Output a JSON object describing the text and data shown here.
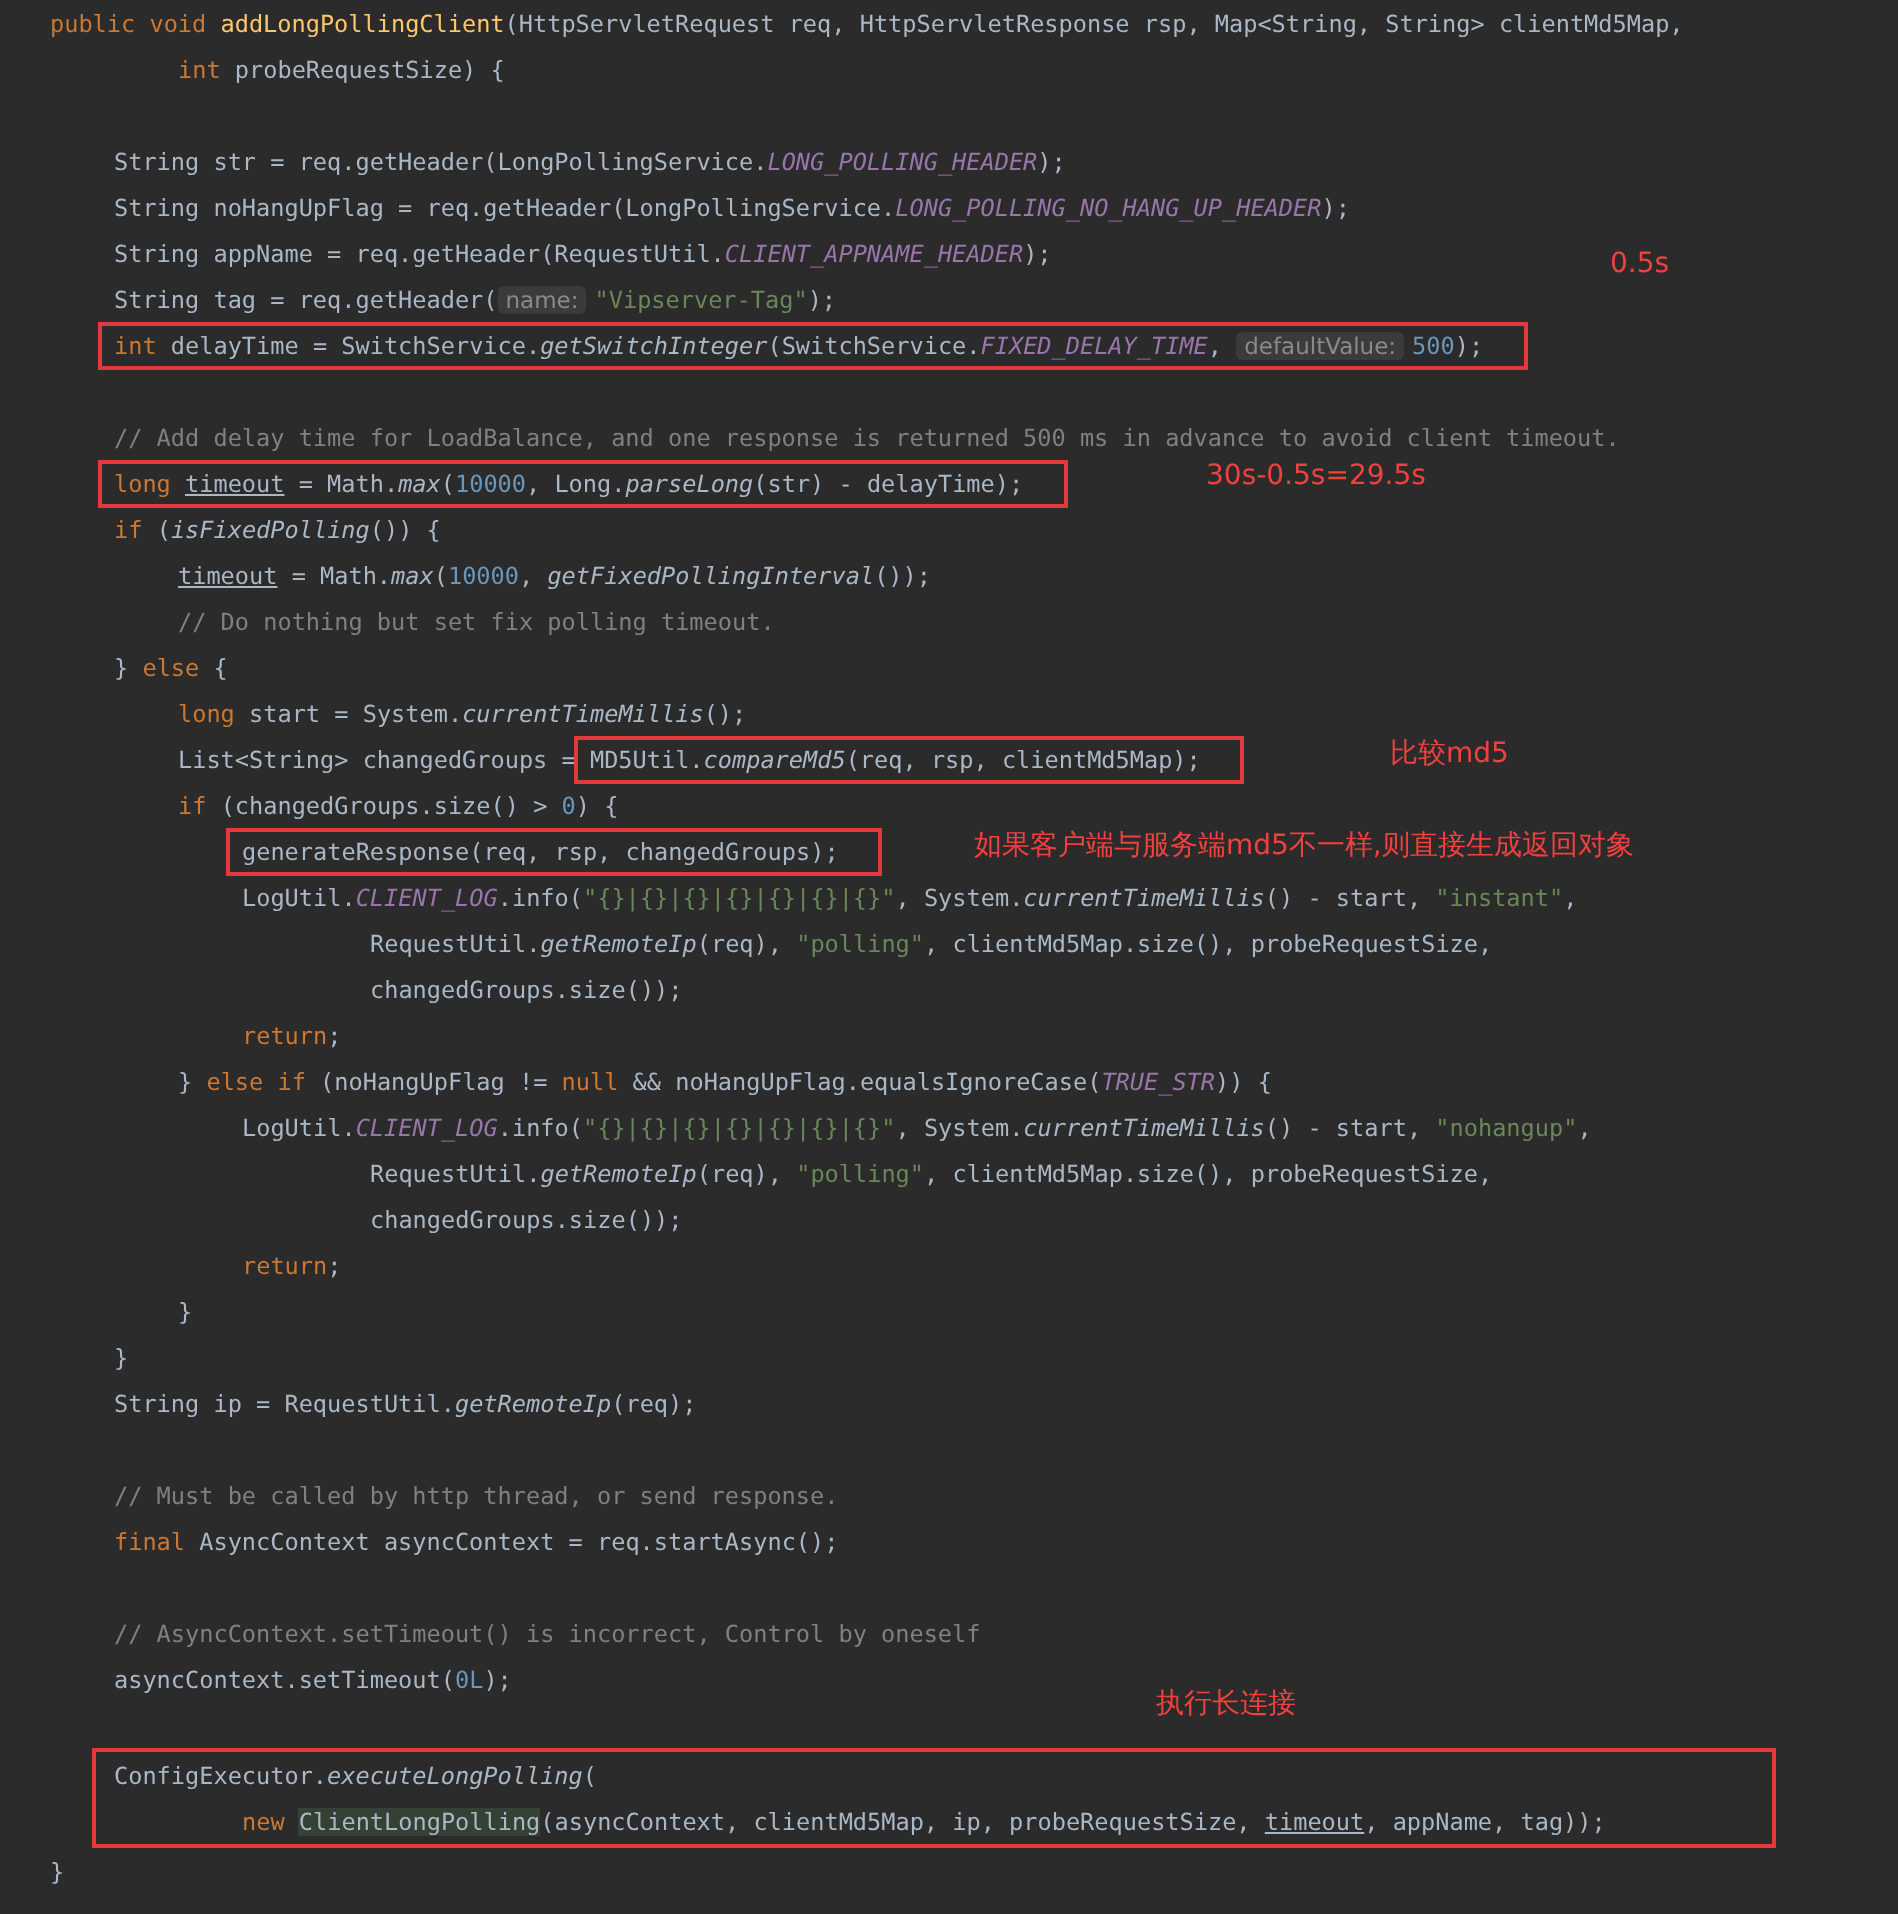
{
  "editor": {
    "lines": [
      {
        "kind": "code",
        "tokens": [
          {
            "kind": "kw",
            "text": "public void "
          },
          {
            "kind": "fn",
            "text": "addLongPollingClient"
          },
          {
            "kind": "plain",
            "text": "(HttpServletRequest req, HttpServletResponse rsp, Map<String, String> clientMd5Map,"
          }
        ]
      },
      {
        "kind": "block",
        "lines": [
          {
            "kind": "block",
            "lines": [
              {
                "kind": "code",
                "tokens": [
                  {
                    "kind": "kw",
                    "text": "int"
                  },
                  {
                    "kind": "plain",
                    "text": " probeRequestSize) {"
                  }
                ]
              }
            ]
          },
          {
            "kind": "blank"
          },
          {
            "kind": "code",
            "tokens": [
              {
                "kind": "plain",
                "text": "String str = req.getHeader(LongPollingService."
              },
              {
                "kind": "const",
                "text": "LONG_POLLING_HEADER"
              },
              {
                "kind": "plain",
                "text": ");"
              }
            ]
          },
          {
            "kind": "code",
            "tokens": [
              {
                "kind": "plain",
                "text": "String noHangUpFlag = req.getHeader(LongPollingService."
              },
              {
                "kind": "const",
                "text": "LONG_POLLING_NO_HANG_UP_HEADER"
              },
              {
                "kind": "plain",
                "text": ");"
              }
            ]
          },
          {
            "kind": "code",
            "tokens": [
              {
                "kind": "plain",
                "text": "String appName = req.getHeader(RequestUtil."
              },
              {
                "kind": "const",
                "text": "CLIENT_APPNAME_HEADER"
              },
              {
                "kind": "plain",
                "text": ");"
              }
            ]
          },
          {
            "kind": "code",
            "note": "0.5s",
            "tokens": [
              {
                "kind": "plain",
                "text": "String tag = req.getHeader("
              },
              {
                "kind": "hint",
                "text": "name:"
              },
              {
                "kind": "str",
                "text": "\"Vipserver-Tag\""
              },
              {
                "kind": "plain",
                "text": ");"
              }
            ]
          },
          {
            "kind": "code",
            "tokens": [
              {
                "kind": "box",
                "tokens": [
                  {
                    "kind": "kw",
                    "text": "int"
                  },
                  {
                    "kind": "plain",
                    "text": " delayTime = SwitchService."
                  },
                  {
                    "kind": "static",
                    "text": "getSwitchInteger"
                  },
                  {
                    "kind": "plain",
                    "text": "(SwitchService."
                  },
                  {
                    "kind": "const",
                    "text": "FIXED_DELAY_TIME"
                  },
                  {
                    "kind": "plain",
                    "text": ", "
                  },
                  {
                    "kind": "hint",
                    "text": "defaultValue:"
                  },
                  {
                    "kind": "num",
                    "text": "500"
                  },
                  {
                    "kind": "plain",
                    "text": ");"
                  }
                ]
              }
            ]
          },
          {
            "kind": "blank"
          },
          {
            "kind": "code",
            "tokens": [
              {
                "kind": "comment",
                "text": "// Add delay time for LoadBalance, and one response is returned 500 ms in advance to avoid client timeout."
              }
            ]
          },
          {
            "kind": "code",
            "note": "30s-0.5s=29.5s",
            "tokens": [
              {
                "kind": "box",
                "tokens": [
                  {
                    "kind": "kw",
                    "text": "long "
                  },
                  {
                    "kind": "under",
                    "text": "timeout"
                  },
                  {
                    "kind": "plain",
                    "text": " = Math."
                  },
                  {
                    "kind": "static",
                    "text": "max"
                  },
                  {
                    "kind": "plain",
                    "text": "("
                  },
                  {
                    "kind": "num",
                    "text": "10000"
                  },
                  {
                    "kind": "plain",
                    "text": ", Long."
                  },
                  {
                    "kind": "static",
                    "text": "parseLong"
                  },
                  {
                    "kind": "plain",
                    "text": "(str) - delayTime);"
                  }
                ]
              }
            ]
          },
          {
            "kind": "code",
            "tokens": [
              {
                "kind": "kw",
                "text": "if"
              },
              {
                "kind": "plain",
                "text": " ("
              },
              {
                "kind": "static",
                "text": "isFixedPolling"
              },
              {
                "kind": "plain",
                "text": "()) {"
              }
            ]
          },
          {
            "kind": "block",
            "lines": [
              {
                "kind": "code",
                "tokens": [
                  {
                    "kind": "under",
                    "text": "timeout"
                  },
                  {
                    "kind": "plain",
                    "text": " = Math."
                  },
                  {
                    "kind": "static",
                    "text": "max"
                  },
                  {
                    "kind": "plain",
                    "text": "("
                  },
                  {
                    "kind": "num",
                    "text": "10000"
                  },
                  {
                    "kind": "plain",
                    "text": ", "
                  },
                  {
                    "kind": "static",
                    "text": "getFixedPollingInterval"
                  },
                  {
                    "kind": "plain",
                    "text": "());"
                  }
                ]
              },
              {
                "kind": "code",
                "tokens": [
                  {
                    "kind": "comment",
                    "text": "// Do nothing but set fix polling timeout."
                  }
                ]
              }
            ]
          },
          {
            "kind": "code",
            "tokens": [
              {
                "kind": "plain",
                "text": "} "
              },
              {
                "kind": "kw",
                "text": "else"
              },
              {
                "kind": "plain",
                "text": " {"
              }
            ]
          },
          {
            "kind": "block",
            "lines": [
              {
                "kind": "code",
                "tokens": [
                  {
                    "kind": "kw",
                    "text": "long"
                  },
                  {
                    "kind": "plain",
                    "text": " start = System."
                  },
                  {
                    "kind": "static",
                    "text": "currentTimeMillis"
                  },
                  {
                    "kind": "plain",
                    "text": "();"
                  }
                ]
              },
              {
                "kind": "code",
                "note": "比较md5",
                "tokens": [
                  {
                    "kind": "plain",
                    "text": "List<String> changedGroups = "
                  },
                  {
                    "kind": "box",
                    "tokens": [
                      {
                        "kind": "plain",
                        "text": "MD5Util."
                      },
                      {
                        "kind": "static",
                        "text": "compareMd5"
                      },
                      {
                        "kind": "plain",
                        "text": "(req, rsp, clientMd5Map);"
                      }
                    ]
                  }
                ]
              },
              {
                "kind": "code",
                "tokens": [
                  {
                    "kind": "kw",
                    "text": "if"
                  },
                  {
                    "kind": "plain",
                    "text": " (changedGroups.size() > "
                  },
                  {
                    "kind": "num",
                    "text": "0"
                  },
                  {
                    "kind": "plain",
                    "text": ") {"
                  }
                ]
              },
              {
                "kind": "block",
                "lines": [
                  {
                    "kind": "code",
                    "note": "如果客户端与服务端md5不一样,则直接生成返回对象",
                    "tokens": [
                      {
                        "kind": "box",
                        "tokens": [
                          {
                            "kind": "plain",
                            "text": "generateResponse(req, rsp, changedGroups);"
                          }
                        ]
                      }
                    ]
                  },
                  {
                    "kind": "code",
                    "tokens": [
                      {
                        "kind": "plain",
                        "text": "LogUtil."
                      },
                      {
                        "kind": "const",
                        "text": "CLIENT_LOG"
                      },
                      {
                        "kind": "plain",
                        "text": ".info("
                      },
                      {
                        "kind": "str",
                        "text": "\"{}|{}|{}|{}|{}|{}|{}\""
                      },
                      {
                        "kind": "plain",
                        "text": ", System."
                      },
                      {
                        "kind": "static",
                        "text": "currentTimeMillis"
                      },
                      {
                        "kind": "plain",
                        "text": "() - start, "
                      },
                      {
                        "kind": "str",
                        "text": "\"instant\""
                      },
                      {
                        "kind": "plain",
                        "text": ","
                      }
                    ]
                  },
                  {
                    "kind": "block",
                    "lines": [
                      {
                        "kind": "block",
                        "lines": [
                          {
                            "kind": "code",
                            "tokens": [
                              {
                                "kind": "plain",
                                "text": "RequestUtil."
                              },
                              {
                                "kind": "static",
                                "text": "getRemoteIp"
                              },
                              {
                                "kind": "plain",
                                "text": "(req), "
                              },
                              {
                                "kind": "str",
                                "text": "\"polling\""
                              },
                              {
                                "kind": "plain",
                                "text": ", clientMd5Map.size(), probeRequestSize,"
                              }
                            ]
                          },
                          {
                            "kind": "code",
                            "tokens": [
                              {
                                "kind": "plain",
                                "text": "changedGroups.size());"
                              }
                            ]
                          }
                        ]
                      }
                    ]
                  },
                  {
                    "kind": "code",
                    "tokens": [
                      {
                        "kind": "kw",
                        "text": "return"
                      },
                      {
                        "kind": "plain",
                        "text": ";"
                      }
                    ]
                  }
                ]
              },
              {
                "kind": "code",
                "tokens": [
                  {
                    "kind": "plain",
                    "text": "} "
                  },
                  {
                    "kind": "kw",
                    "text": "else if"
                  },
                  {
                    "kind": "plain",
                    "text": " (noHangUpFlag != "
                  },
                  {
                    "kind": "kw",
                    "text": "null"
                  },
                  {
                    "kind": "plain",
                    "text": " && noHangUpFlag.equalsIgnoreCase("
                  },
                  {
                    "kind": "const",
                    "text": "TRUE_STR"
                  },
                  {
                    "kind": "plain",
                    "text": ")) {"
                  }
                ]
              },
              {
                "kind": "block",
                "lines": [
                  {
                    "kind": "code",
                    "tokens": [
                      {
                        "kind": "plain",
                        "text": "LogUtil."
                      },
                      {
                        "kind": "const",
                        "text": "CLIENT_LOG"
                      },
                      {
                        "kind": "plain",
                        "text": ".info("
                      },
                      {
                        "kind": "str",
                        "text": "\"{}|{}|{}|{}|{}|{}|{}\""
                      },
                      {
                        "kind": "plain",
                        "text": ", System."
                      },
                      {
                        "kind": "static",
                        "text": "currentTimeMillis"
                      },
                      {
                        "kind": "plain",
                        "text": "() - start, "
                      },
                      {
                        "kind": "str",
                        "text": "\"nohangup\""
                      },
                      {
                        "kind": "plain",
                        "text": ","
                      }
                    ]
                  },
                  {
                    "kind": "block",
                    "lines": [
                      {
                        "kind": "block",
                        "lines": [
                          {
                            "kind": "code",
                            "tokens": [
                              {
                                "kind": "plain",
                                "text": "RequestUtil."
                              },
                              {
                                "kind": "static",
                                "text": "getRemoteIp"
                              },
                              {
                                "kind": "plain",
                                "text": "(req), "
                              },
                              {
                                "kind": "str",
                                "text": "\"polling\""
                              },
                              {
                                "kind": "plain",
                                "text": ", clientMd5Map.size(), probeRequestSize,"
                              }
                            ]
                          },
                          {
                            "kind": "code",
                            "tokens": [
                              {
                                "kind": "plain",
                                "text": "changedGroups.size());"
                              }
                            ]
                          }
                        ]
                      }
                    ]
                  },
                  {
                    "kind": "code",
                    "tokens": [
                      {
                        "kind": "kw",
                        "text": "return"
                      },
                      {
                        "kind": "plain",
                        "text": ";"
                      }
                    ]
                  }
                ]
              },
              {
                "kind": "code",
                "tokens": [
                  {
                    "kind": "plain",
                    "text": "}"
                  }
                ]
              }
            ]
          },
          {
            "kind": "code",
            "tokens": [
              {
                "kind": "plain",
                "text": "}"
              }
            ]
          },
          {
            "kind": "code",
            "tokens": [
              {
                "kind": "plain",
                "text": "String ip = RequestUtil."
              },
              {
                "kind": "static",
                "text": "getRemoteIp"
              },
              {
                "kind": "plain",
                "text": "(req);"
              }
            ]
          },
          {
            "kind": "blank"
          },
          {
            "kind": "code",
            "tokens": [
              {
                "kind": "comment",
                "text": "// Must be called by http thread, or send response."
              }
            ]
          },
          {
            "kind": "code",
            "tokens": [
              {
                "kind": "kw",
                "text": "final"
              },
              {
                "kind": "plain",
                "text": " AsyncContext asyncContext = req.startAsync();"
              }
            ]
          },
          {
            "kind": "blank"
          },
          {
            "kind": "code",
            "tokens": [
              {
                "kind": "comment",
                "text": "// AsyncContext.setTimeout() is incorrect, Control by oneself"
              }
            ]
          },
          {
            "kind": "code",
            "tokens": [
              {
                "kind": "plain",
                "text": "asyncContext.setTimeout("
              },
              {
                "kind": "num",
                "text": "0L"
              },
              {
                "kind": "plain",
                "text": ");"
              }
            ]
          },
          {
            "kind": "blank",
            "note": "执行长连接"
          },
          {
            "kind": "boxed_group",
            "lines": [
              {
                "kind": "code",
                "tokens": [
                  {
                    "kind": "plain",
                    "text": "ConfigExecutor."
                  },
                  {
                    "kind": "static",
                    "text": "executeLongPolling"
                  },
                  {
                    "kind": "plain",
                    "text": "("
                  }
                ]
              },
              {
                "kind": "block",
                "lines": [
                  {
                    "kind": "block",
                    "lines": [
                      {
                        "kind": "code",
                        "tokens": [
                          {
                            "kind": "kw",
                            "text": "new "
                          },
                          {
                            "kind": "cls",
                            "text": "ClientLongPolling"
                          },
                          {
                            "kind": "plain",
                            "text": "(asyncContext, clientMd5Map, ip, probeRequestSize, "
                          },
                          {
                            "kind": "under",
                            "text": "timeout"
                          },
                          {
                            "kind": "plain",
                            "text": ", appName, tag));"
                          }
                        ]
                      }
                    ]
                  }
                ]
              }
            ]
          }
        ]
      },
      {
        "kind": "code",
        "tokens": [
          {
            "kind": "plain",
            "text": "}"
          }
        ]
      }
    ]
  }
}
